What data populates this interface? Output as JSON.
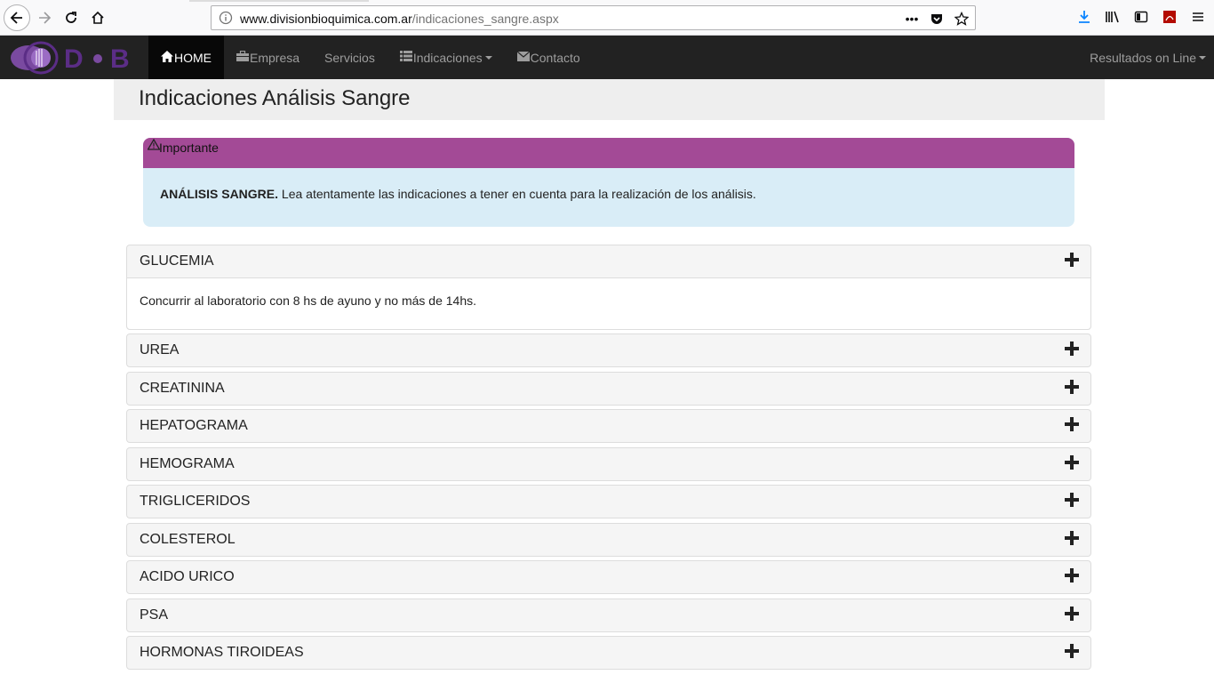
{
  "browser": {
    "url_domain": "www.divisionbioquimica.com.ar",
    "url_path": "/indicaciones_sangre.aspx"
  },
  "navbar": {
    "brand_text": "D•B",
    "items": [
      {
        "label": "HOME",
        "icon": "home-icon"
      },
      {
        "label": "Empresa",
        "icon": "briefcase-icon"
      },
      {
        "label": "Servicios",
        "icon": ""
      },
      {
        "label": "Indicaciones",
        "icon": "list-icon"
      },
      {
        "label": "Contacto",
        "icon": "envelope-icon"
      }
    ],
    "right_label": "Resultados on Line"
  },
  "page": {
    "title": "Indicaciones Análisis Sangre"
  },
  "alert": {
    "heading": "Importante",
    "bold": "ANÁLISIS SANGRE.",
    "text": " Lea atentamente las indicaciones a tener en cuenta para la realización de los análisis."
  },
  "accordion": [
    {
      "title": "GLUCEMIA",
      "body": "Concurrir al laboratorio con 8 hs de ayuno y no más de 14hs."
    },
    {
      "title": "UREA"
    },
    {
      "title": "CREATININA"
    },
    {
      "title": "HEPATOGRAMA"
    },
    {
      "title": "HEMOGRAMA"
    },
    {
      "title": "TRIGLICERIDOS"
    },
    {
      "title": "COLESTEROL"
    },
    {
      "title": "ACIDO URICO"
    },
    {
      "title": "PSA"
    },
    {
      "title": "HORMONAS TIROIDEAS"
    }
  ],
  "colors": {
    "navbar_bg": "#222222",
    "alert_head": "#a34a96",
    "alert_body": "#d9edf7",
    "brand_purple": "#5b2d86"
  }
}
